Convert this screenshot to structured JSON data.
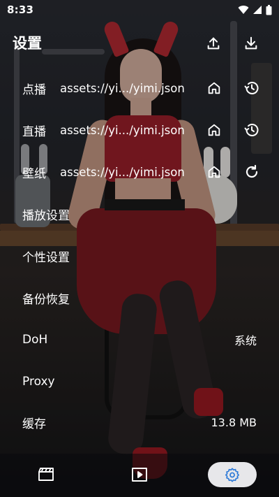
{
  "status_bar": {
    "time": "8:33",
    "icons": [
      "wifi-icon",
      "signal-icon",
      "battery-icon"
    ]
  },
  "header": {
    "title": "设置",
    "actions": [
      "upload-icon",
      "download-icon"
    ]
  },
  "settings": {
    "vod": {
      "label": "点播",
      "value": "assets://yi.../yimi.json",
      "icons": [
        "home-icon",
        "history-icon"
      ]
    },
    "live": {
      "label": "直播",
      "value": "assets://yi.../yimi.json",
      "icons": [
        "home-icon",
        "history-icon"
      ]
    },
    "wall": {
      "label": "壁纸",
      "value": "assets://yi.../yimi.json",
      "icons": [
        "home-icon",
        "refresh-icon"
      ]
    },
    "player": {
      "label": "播放设置"
    },
    "custom": {
      "label": "个性设置"
    },
    "backup": {
      "label": "备份恢复"
    },
    "doh": {
      "label": "DoH",
      "value": "系统"
    },
    "proxy": {
      "label": "Proxy"
    },
    "cache": {
      "label": "缓存",
      "value": "13.8 MB"
    }
  },
  "bottom_nav": {
    "items": [
      "film-icon",
      "play-icon",
      "settings-gear-icon"
    ],
    "active": "settings-gear-icon"
  },
  "colors": {
    "text": "#ffffff",
    "nav_active_bg": "#e7e7ea",
    "nav_active_icon": "#2f7bd8"
  }
}
